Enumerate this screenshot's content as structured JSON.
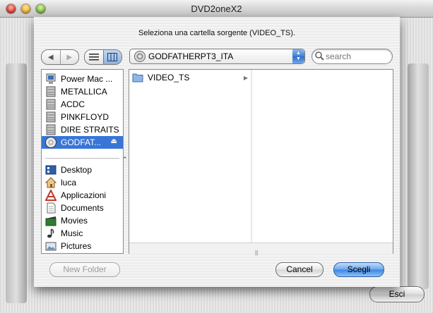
{
  "window": {
    "title": "DVD2oneX2",
    "exit_label": "Esci"
  },
  "dialog": {
    "title": "Seleziona una cartella sorgente (VIDEO_TS).",
    "location": "GODFATHERPT3_ITA",
    "search_placeholder": "search",
    "sidebar_devices": [
      {
        "label": "Power Mac ...",
        "icon": "computer-icon"
      },
      {
        "label": "METALLICA",
        "icon": "drive-icon"
      },
      {
        "label": "ACDC",
        "icon": "drive-icon"
      },
      {
        "label": "PINKFLOYD",
        "icon": "drive-icon"
      },
      {
        "label": "DIRE STRAITS",
        "icon": "drive-icon"
      },
      {
        "label": "GODFAT...",
        "icon": "dvd-icon",
        "selected": true
      }
    ],
    "sidebar_places": [
      {
        "label": "Desktop",
        "icon": "desktop-icon"
      },
      {
        "label": "luca",
        "icon": "home-icon"
      },
      {
        "label": "Applicazioni",
        "icon": "applications-icon"
      },
      {
        "label": "Documents",
        "icon": "documents-icon"
      },
      {
        "label": "Movies",
        "icon": "movies-icon"
      },
      {
        "label": "Music",
        "icon": "music-icon"
      },
      {
        "label": "Pictures",
        "icon": "pictures-icon"
      }
    ],
    "files": [
      {
        "label": "VIDEO_TS",
        "icon": "folder-icon"
      }
    ],
    "buttons": {
      "new_folder": "New Folder",
      "cancel": "Cancel",
      "choose": "Scegli"
    }
  },
  "colors": {
    "selection": "#3875d7",
    "default_button": "#3b84e0"
  }
}
